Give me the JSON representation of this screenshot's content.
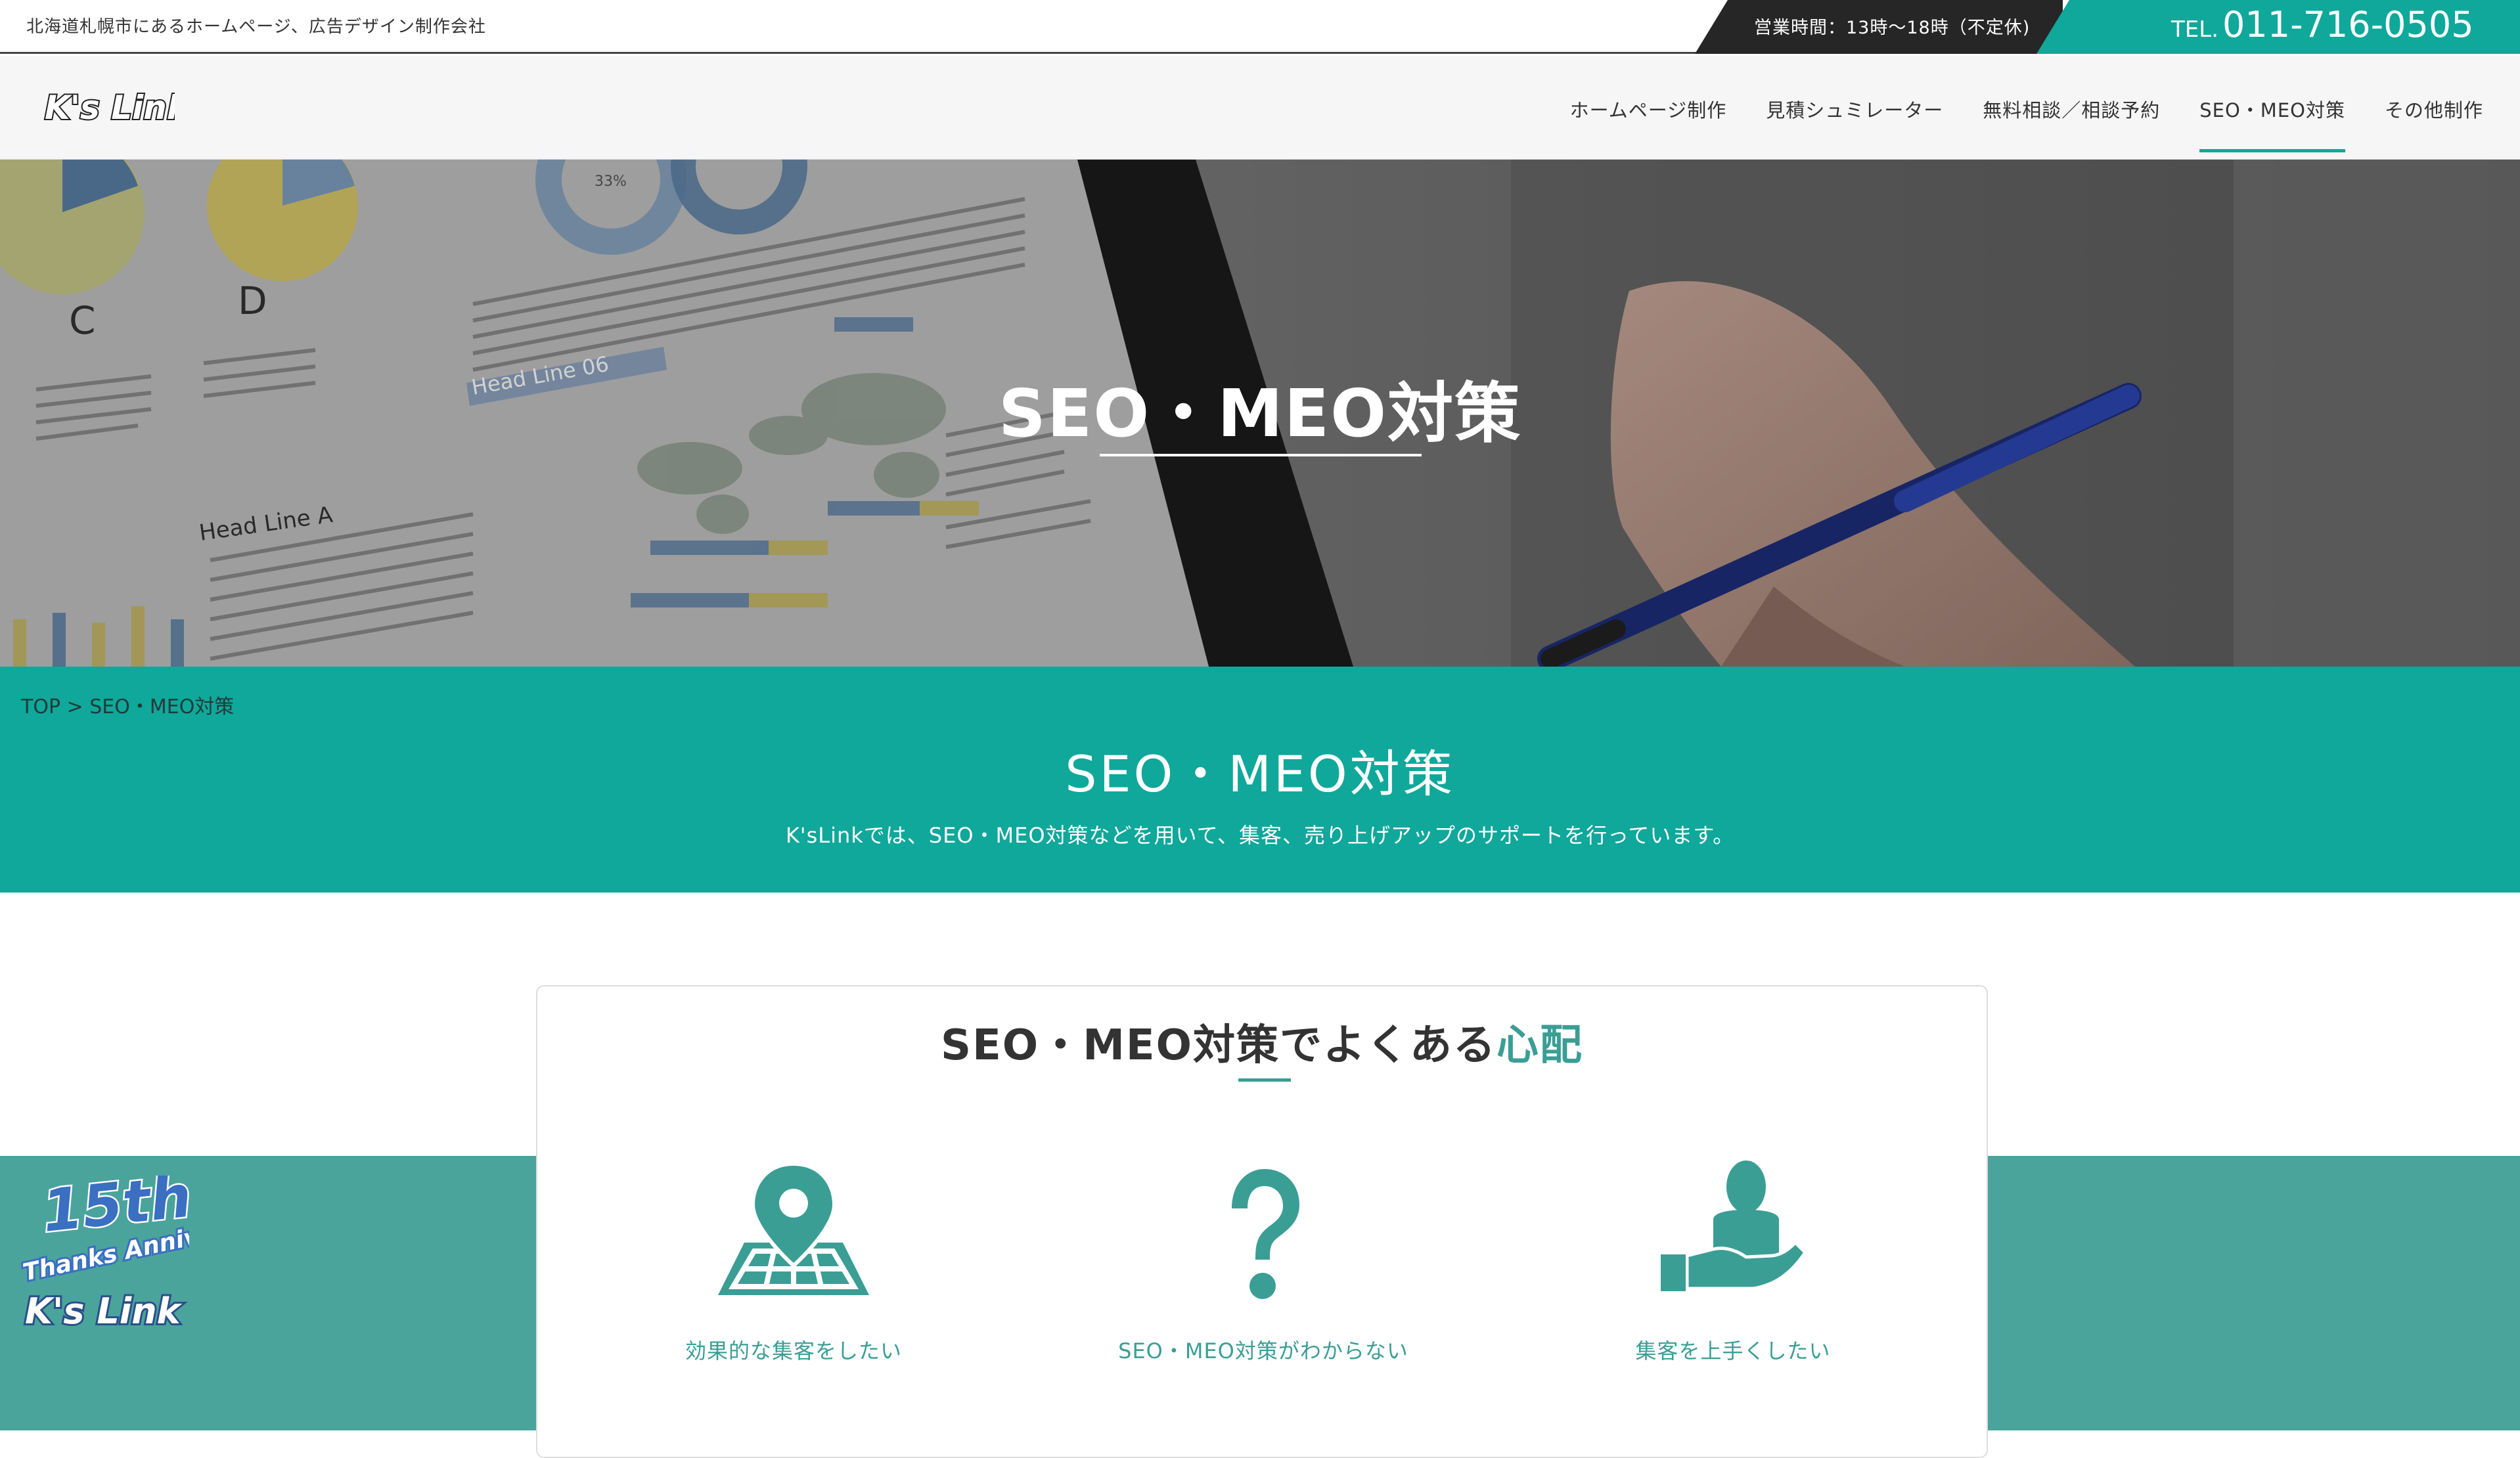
{
  "topbar": {
    "tagline": "北海道札幌市にあるホームページ、広告デザイン制作会社",
    "hours": "営業時間：13時〜18時（不定休)",
    "tel_label": "TEL.",
    "tel_number": "011-716-0505"
  },
  "header": {
    "logo_text": "K's Link",
    "nav": [
      {
        "label": "ホームページ制作",
        "active": false
      },
      {
        "label": "見積シュミレーター",
        "active": false
      },
      {
        "label": "無料相談／相談予約",
        "active": false
      },
      {
        "label": "SEO・MEO対策",
        "active": true
      },
      {
        "label": "その他制作",
        "active": false
      }
    ]
  },
  "hero": {
    "title": "SEO・MEO対策",
    "image_text": {
      "pct": "33%",
      "letter_c": "C",
      "letter_d": "D",
      "headline_06": "Head Line 06",
      "headline_a": "Head Line A"
    }
  },
  "intro": {
    "breadcrumb": "TOP > SEO・MEO対策",
    "title": "SEO・MEO対策",
    "subtitle": "K'sLinkでは、SEO・MEO対策などを用いて、集客、売り上げアップのサポートを行っています。"
  },
  "worries": {
    "title_main": "SEO・MEO対策でよくある",
    "title_highlight": "心配",
    "items": [
      {
        "icon": "map-pin-icon",
        "label": "効果的な集客をしたい"
      },
      {
        "icon": "question-mark-icon",
        "label": "SEO・MEO対策がわからない"
      },
      {
        "icon": "person-hand-icon",
        "label": "集客を上手くしたい"
      }
    ]
  },
  "badge": {
    "line1": "15th",
    "line2": "Thanks Anniv.",
    "line3": "K's Link"
  },
  "colors": {
    "accent": "#0fa89b",
    "accent_dark": "#3a9e95",
    "lower_teal": "#4aa49b",
    "dark_box": "#262626"
  }
}
